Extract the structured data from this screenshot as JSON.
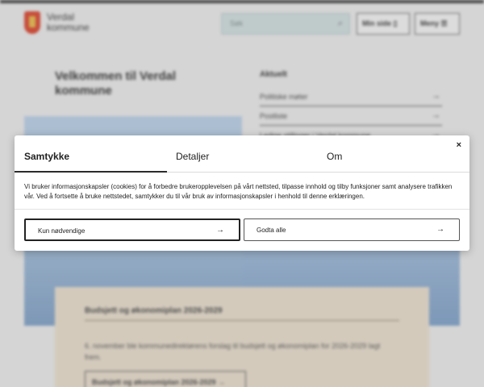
{
  "header": {
    "brand_line1": "Verdal",
    "brand_line2": "kommune",
    "search_placeholder": "Søk",
    "minside_label": "Min side",
    "meny_label": "Meny"
  },
  "main": {
    "welcome_title": "Velkommen til Verdal kommune",
    "aktuelt_heading": "Aktuelt",
    "aktuelt_items": [
      "Politiske møter",
      "Postliste",
      "Ledige stillinger i Verdal kommune"
    ]
  },
  "budget_card": {
    "title": "Budsjett og økonomiplan 2026-2029",
    "text": "6. november ble kommunedirektørens forslag til budsjett og økonomiplan for 2026-2029 lagt frem.",
    "button_label": "Budsjett og økonomiplan 2026-2029"
  },
  "consent": {
    "tabs": [
      "Samtykke",
      "Detaljer",
      "Om"
    ],
    "active_tab": "Samtykke",
    "close_symbol": "×",
    "description": "Vi bruker informasjonskapsler (cookies) for å forbedre brukeropplevelsen på vårt nettsted, tilpasse innhold og tilby funksjoner samt analysere trafikken vår. Ved å fortsette å bruke nettstedet, samtykker du til vår bruk av informasjonskapsler i henhold til denne erklæringen.",
    "necessary_button": "Kun nødvendige",
    "accept_all_button": "Godta alle"
  },
  "icons": {
    "search": "search-icon",
    "arrow": "arrow-right-icon",
    "close": "close-icon"
  },
  "colors": {
    "logo_red": "#d8432e",
    "search_bg": "#cfdcdd",
    "card_bg": "#e7dccb"
  }
}
